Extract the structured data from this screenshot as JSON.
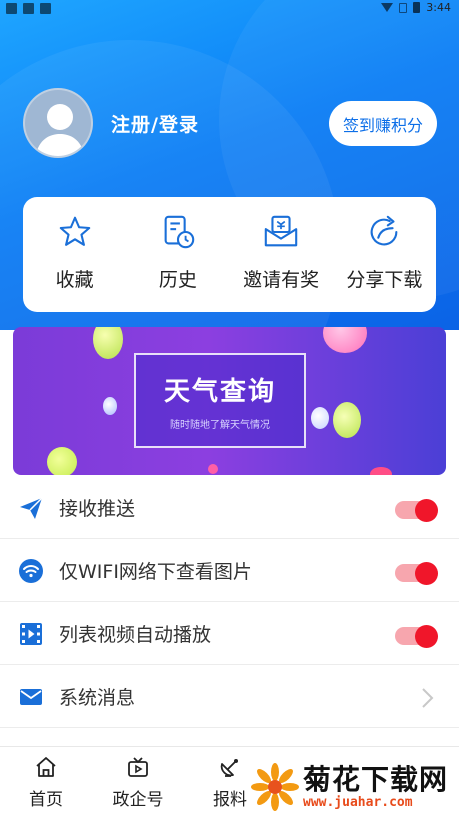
{
  "status_bar": {
    "time": "3:44"
  },
  "profile": {
    "login_label": "注册/登录",
    "signin_button": "签到赚积分"
  },
  "quick_actions": [
    {
      "label": "收藏",
      "icon": "star-icon"
    },
    {
      "label": "历史",
      "icon": "history-icon"
    },
    {
      "label": "邀请有奖",
      "icon": "invite-icon"
    },
    {
      "label": "分享下载",
      "icon": "share-icon"
    }
  ],
  "banner": {
    "title": "天气查询",
    "subtitle": "随时随地了解天气情况"
  },
  "settings": [
    {
      "label": "接收推送",
      "icon": "paper-plane-icon",
      "type": "toggle",
      "on": true
    },
    {
      "label": "仅WIFI网络下查看图片",
      "icon": "wifi-icon",
      "type": "toggle",
      "on": true
    },
    {
      "label": "列表视频自动播放",
      "icon": "video-icon",
      "type": "toggle",
      "on": true
    },
    {
      "label": "系统消息",
      "icon": "mail-icon",
      "type": "link"
    }
  ],
  "tabs": [
    {
      "label": "首页",
      "icon": "home-icon"
    },
    {
      "label": "政企号",
      "icon": "tv-icon"
    },
    {
      "label": "报料",
      "icon": "satellite-icon"
    }
  ],
  "watermark": {
    "title": "菊花下载网",
    "url": "www.juahar.com"
  },
  "colors": {
    "header_blue": "#0a7df5",
    "accent_red": "#f0162a",
    "icon_blue": "#1a6fd8"
  }
}
